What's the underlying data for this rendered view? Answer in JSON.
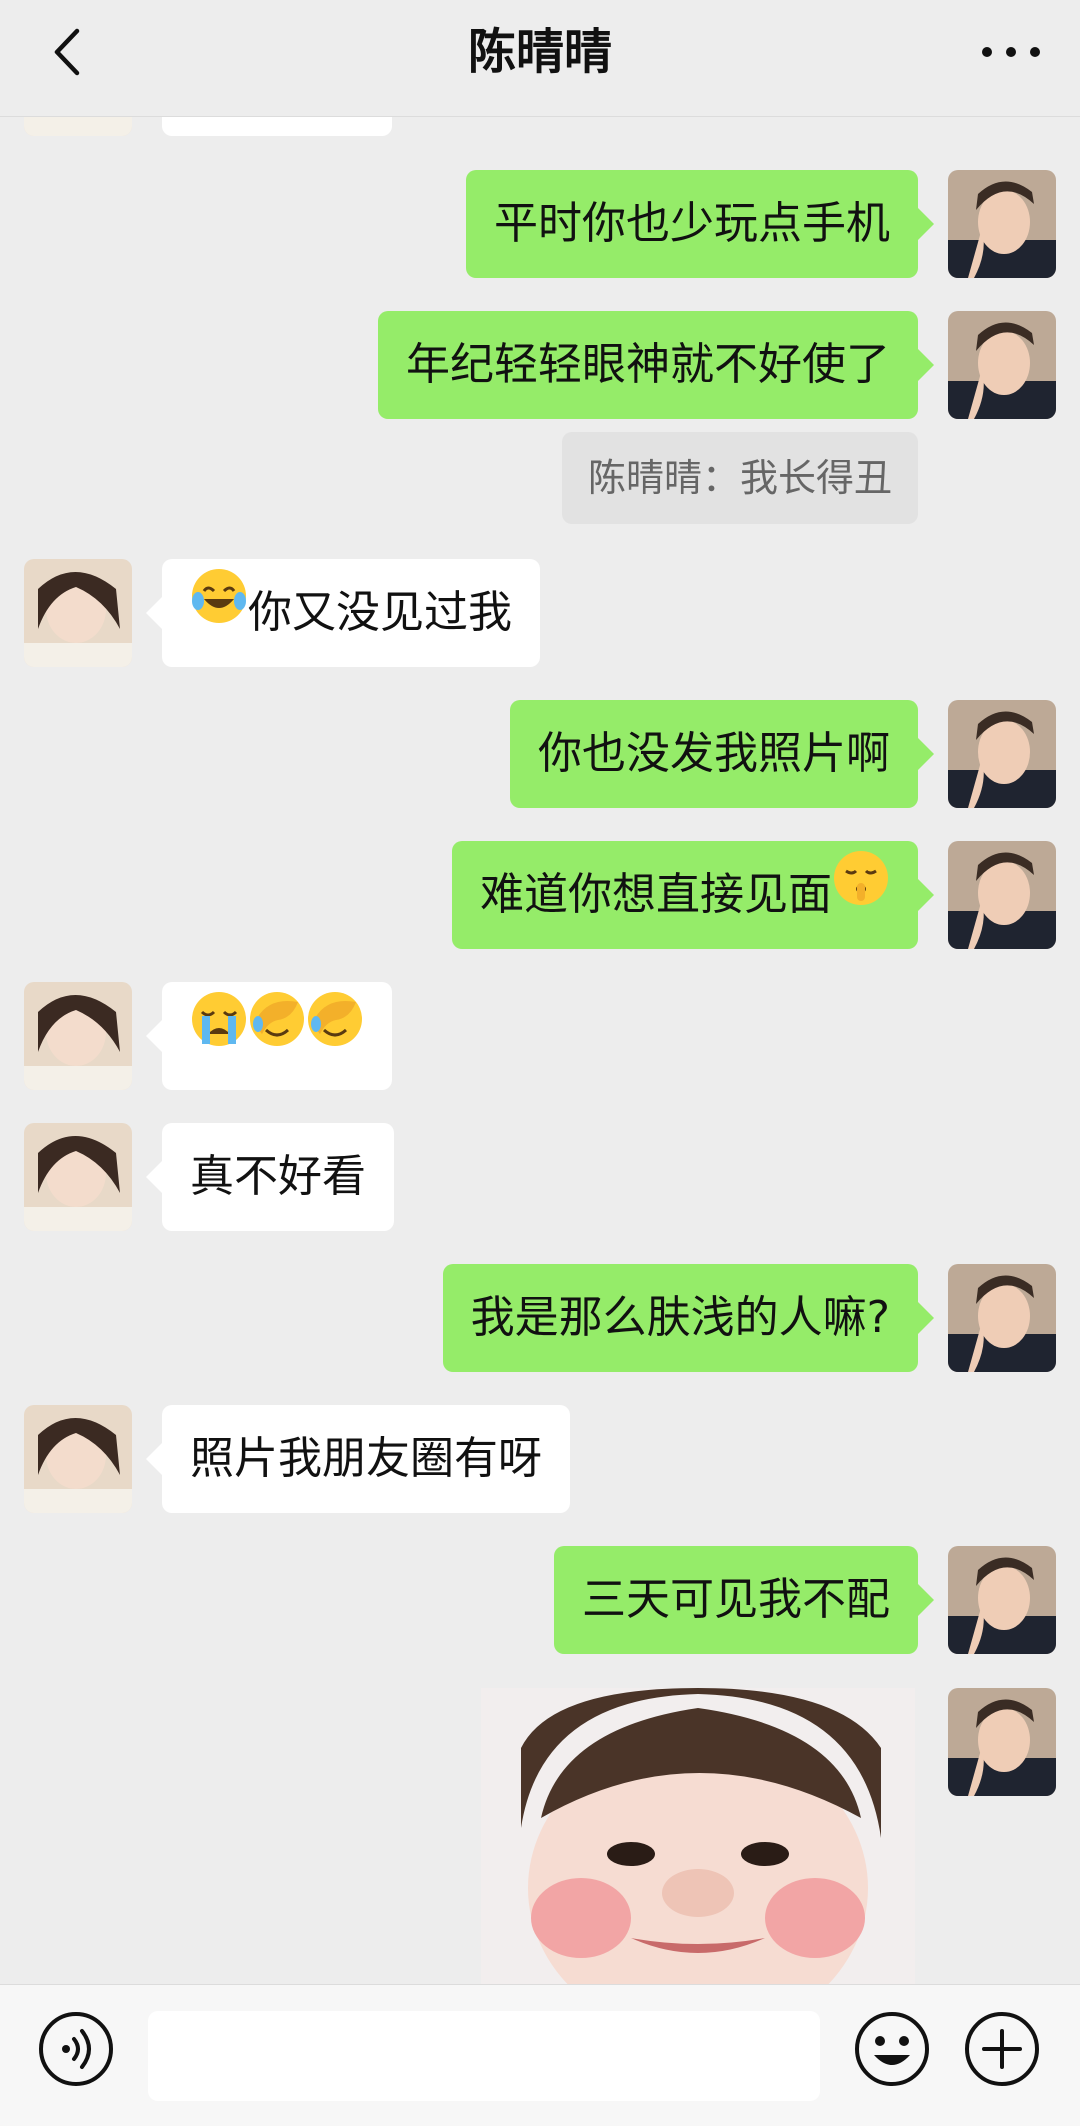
{
  "header": {
    "title": "陈晴晴"
  },
  "messages": [
    {
      "side": "in",
      "text": ""
    },
    {
      "side": "out",
      "text": "平时你也少玩点手机"
    },
    {
      "side": "out",
      "text": "年纪轻轻眼神就不好使了"
    },
    {
      "side": "quote",
      "text": "陈晴晴：我长得丑"
    },
    {
      "side": "in",
      "text": "你又没见过我",
      "prefix_emoji": "tears-of-joy-emoji"
    },
    {
      "side": "out",
      "text": "你也没发我照片啊"
    },
    {
      "side": "out",
      "text": "难道你想直接见面",
      "suffix_emoji": "shushing-face-emoji"
    },
    {
      "side": "in",
      "text": "",
      "emojis": [
        "loudly-crying-emoji",
        "face-palm-emoji",
        "face-palm-emoji"
      ]
    },
    {
      "side": "in",
      "text": "真不好看"
    },
    {
      "side": "out",
      "text": "我是那么肤浅的人嘛?"
    },
    {
      "side": "in",
      "text": "照片我朋友圈有呀"
    },
    {
      "side": "out",
      "text": "三天可见我不配"
    },
    {
      "side": "out",
      "type": "sticker",
      "sticker": "crying-child-face-sticker"
    }
  ],
  "composer": {
    "placeholder": ""
  },
  "icons": {
    "back": "chevron-left-icon",
    "more": "more-dots-icon",
    "voice": "voice-icon",
    "emoji": "emoji-icon",
    "plus": "plus-icon"
  },
  "colors": {
    "background": "#ededed",
    "outgoing_bubble": "#95ec69",
    "incoming_bubble": "#ffffff",
    "quote_bubble": "#e2e2e2"
  }
}
